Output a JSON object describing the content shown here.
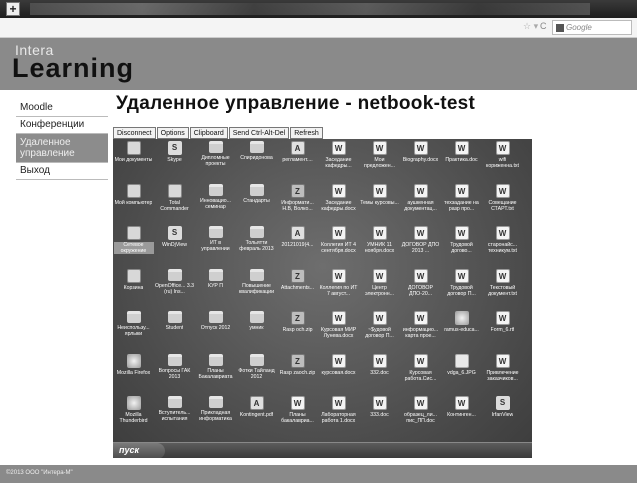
{
  "browser": {
    "new_tab_label": "+",
    "search_placeholder": "Google"
  },
  "header": {
    "logo_top": "Intera",
    "logo_main": "Learning"
  },
  "sidebar": {
    "items": [
      {
        "label": "Moodle"
      },
      {
        "label": "Конференции"
      },
      {
        "label": "Удаленное управление"
      },
      {
        "label": "Выход"
      }
    ]
  },
  "main": {
    "title": "Удаленное управление - netbook-test",
    "toolbar": [
      "Disconnect",
      "Options",
      "Clipboard",
      "Send Ctrl-Alt-Del",
      "Refresh"
    ]
  },
  "desktop": {
    "icons": [
      {
        "label": "Мои документы",
        "icon": "my-documents-icon",
        "type": "sys"
      },
      {
        "label": "Skype",
        "icon": "skype-icon",
        "type": "app"
      },
      {
        "label": "Дипломные проекты",
        "icon": "folder-icon",
        "type": "folder"
      },
      {
        "label": "Спиридонова",
        "icon": "folder-icon",
        "type": "folder"
      },
      {
        "label": "регламент....",
        "icon": "pdf-icon",
        "type": "pdf"
      },
      {
        "label": "Заседание кафедры...",
        "icon": "word-doc-icon",
        "type": "doc"
      },
      {
        "label": "Мои предложен...",
        "icon": "word-doc-icon",
        "type": "doc"
      },
      {
        "label": "Biography.docx",
        "icon": "word-doc-icon",
        "type": "doc"
      },
      {
        "label": "Практика.doc",
        "icon": "word-doc-icon",
        "type": "doc"
      },
      {
        "label": "wifi кориженна.txt",
        "icon": "text-file-icon",
        "type": "doc"
      },
      {
        "label": "Мой компьютер",
        "icon": "my-computer-icon",
        "type": "sys"
      },
      {
        "label": "Total Commander",
        "icon": "total-commander-icon",
        "type": "sys"
      },
      {
        "label": "Инновацио... семинар",
        "icon": "folder-icon",
        "type": "folder"
      },
      {
        "label": "Стандарты",
        "icon": "folder-icon",
        "type": "folder"
      },
      {
        "label": "Информати... Н.В, Волко...",
        "icon": "shortcut-icon",
        "type": "zip"
      },
      {
        "label": "Заседание кафедры.docx",
        "icon": "word-doc-icon",
        "type": "doc"
      },
      {
        "label": "Темы курсовы...",
        "icon": "word-doc-icon",
        "type": "doc"
      },
      {
        "label": "аушкенная документац...",
        "icon": "word-doc-icon",
        "type": "doc"
      },
      {
        "label": "техзадание на разр про...",
        "icon": "word-doc-icon",
        "type": "doc"
      },
      {
        "label": "Совещание СТАРТ.txt",
        "icon": "text-file-icon",
        "type": "doc"
      },
      {
        "label": "Сетевое окружение",
        "icon": "network-icon",
        "type": "sys",
        "selected": true
      },
      {
        "label": "WinDjView",
        "icon": "windjview-icon",
        "type": "app"
      },
      {
        "label": "ИТ в управлении",
        "icon": "folder-icon",
        "type": "folder"
      },
      {
        "label": "Тольятти февраль 2013",
        "icon": "folder-icon",
        "type": "folder"
      },
      {
        "label": "20121019(4...",
        "icon": "pdf-icon",
        "type": "pdf"
      },
      {
        "label": "Коллегия ИТ 4 сентября.docx",
        "icon": "word-doc-icon",
        "type": "doc"
      },
      {
        "label": "УМНИК 11 ноября.docx",
        "icon": "word-doc-icon",
        "type": "doc"
      },
      {
        "label": "ДОГОВОР ДПО 2013 ...",
        "icon": "word-doc-icon",
        "type": "doc"
      },
      {
        "label": "Трудовой догово...",
        "icon": "word-doc-icon",
        "type": "doc"
      },
      {
        "label": "старонайс... техникум.txt",
        "icon": "text-file-icon",
        "type": "doc"
      },
      {
        "label": "Корзина",
        "icon": "recycle-bin-icon",
        "type": "sys"
      },
      {
        "label": "OpenOffice... 3.3 (ru) Ins...",
        "icon": "folder-icon",
        "type": "folder"
      },
      {
        "label": "КУР П",
        "icon": "folder-icon",
        "type": "folder"
      },
      {
        "label": "Повышение квалификации",
        "icon": "folder-icon",
        "type": "folder"
      },
      {
        "label": "Attachments...",
        "icon": "zip-icon",
        "type": "zip"
      },
      {
        "label": "Коллегия по ИТ 7 август...",
        "icon": "word-doc-icon",
        "type": "doc"
      },
      {
        "label": "Центр электронн...",
        "icon": "word-doc-icon",
        "type": "doc"
      },
      {
        "label": "ДОГОВОР ДПО-20...",
        "icon": "word-doc-icon",
        "type": "doc"
      },
      {
        "label": "Трудовой договор П...",
        "icon": "word-doc-icon",
        "type": "doc"
      },
      {
        "label": "Текстовый документ.txt",
        "icon": "text-file-icon",
        "type": "doc"
      },
      {
        "label": "Неиспользу... ярлыки",
        "icon": "folder-icon",
        "type": "folder"
      },
      {
        "label": "Student",
        "icon": "folder-icon",
        "type": "folder"
      },
      {
        "label": "Отпуск 2012",
        "icon": "folder-icon",
        "type": "folder"
      },
      {
        "label": "умник",
        "icon": "folder-icon",
        "type": "folder"
      },
      {
        "label": "Rasp och.zip",
        "icon": "zip-icon",
        "type": "zip"
      },
      {
        "label": "Курсовая МИР Лунева.docx",
        "icon": "word-doc-icon",
        "type": "doc"
      },
      {
        "label": "~$удовой договор П...",
        "icon": "word-doc-icon",
        "type": "doc"
      },
      {
        "label": "информацио... карта прое...",
        "icon": "word-doc-icon",
        "type": "doc"
      },
      {
        "label": "ramus-educa...",
        "icon": "ramus-icon",
        "type": "web"
      },
      {
        "label": "Form_6.rtf",
        "icon": "rtf-icon",
        "type": "doc"
      },
      {
        "label": "Mozilla Firefox",
        "icon": "firefox-icon",
        "type": "web"
      },
      {
        "label": "Вопросы ГАК 2013",
        "icon": "folder-icon",
        "type": "folder"
      },
      {
        "label": "Планы Бакалавриата",
        "icon": "folder-icon",
        "type": "folder"
      },
      {
        "label": "Фотки Тайланд 2012",
        "icon": "folder-icon",
        "type": "folder"
      },
      {
        "label": "Rasp zaoch.zip",
        "icon": "zip-icon",
        "type": "zip"
      },
      {
        "label": "курсовая.docx",
        "icon": "word-doc-icon",
        "type": "doc"
      },
      {
        "label": "332.doc",
        "icon": "word-doc-icon",
        "type": "doc"
      },
      {
        "label": "Курсовая работа.Сис...",
        "icon": "word-doc-icon",
        "type": "doc"
      },
      {
        "label": "vdga_6.JPG",
        "icon": "image-icon",
        "type": "img"
      },
      {
        "label": "Привлечение заказчиков...",
        "icon": "word-doc-icon",
        "type": "doc"
      },
      {
        "label": "Mozilla Thunderbird",
        "icon": "thunderbird-icon",
        "type": "web"
      },
      {
        "label": "Вступитель... испытания",
        "icon": "folder-icon",
        "type": "folder"
      },
      {
        "label": "Прикладная информатика",
        "icon": "folder-icon",
        "type": "folder"
      },
      {
        "label": "Kontingent.pdf",
        "icon": "pdf-icon",
        "type": "pdf"
      },
      {
        "label": "Планы бакалавриа...",
        "icon": "word-doc-icon",
        "type": "doc"
      },
      {
        "label": "Лабораторная работа 1.docx",
        "icon": "word-doc-icon",
        "type": "doc"
      },
      {
        "label": "333.doc",
        "icon": "word-doc-icon",
        "type": "doc"
      },
      {
        "label": "образец_ли... пис_ПП.doc",
        "icon": "word-doc-icon",
        "type": "doc"
      },
      {
        "label": "Континген...",
        "icon": "word-doc-icon",
        "type": "doc"
      },
      {
        "label": "IrfanView",
        "icon": "irfanview-icon",
        "type": "app"
      }
    ],
    "start_label": "пуск"
  },
  "footer": {
    "copyright": "©2013 ООО \"Интера-М\""
  }
}
